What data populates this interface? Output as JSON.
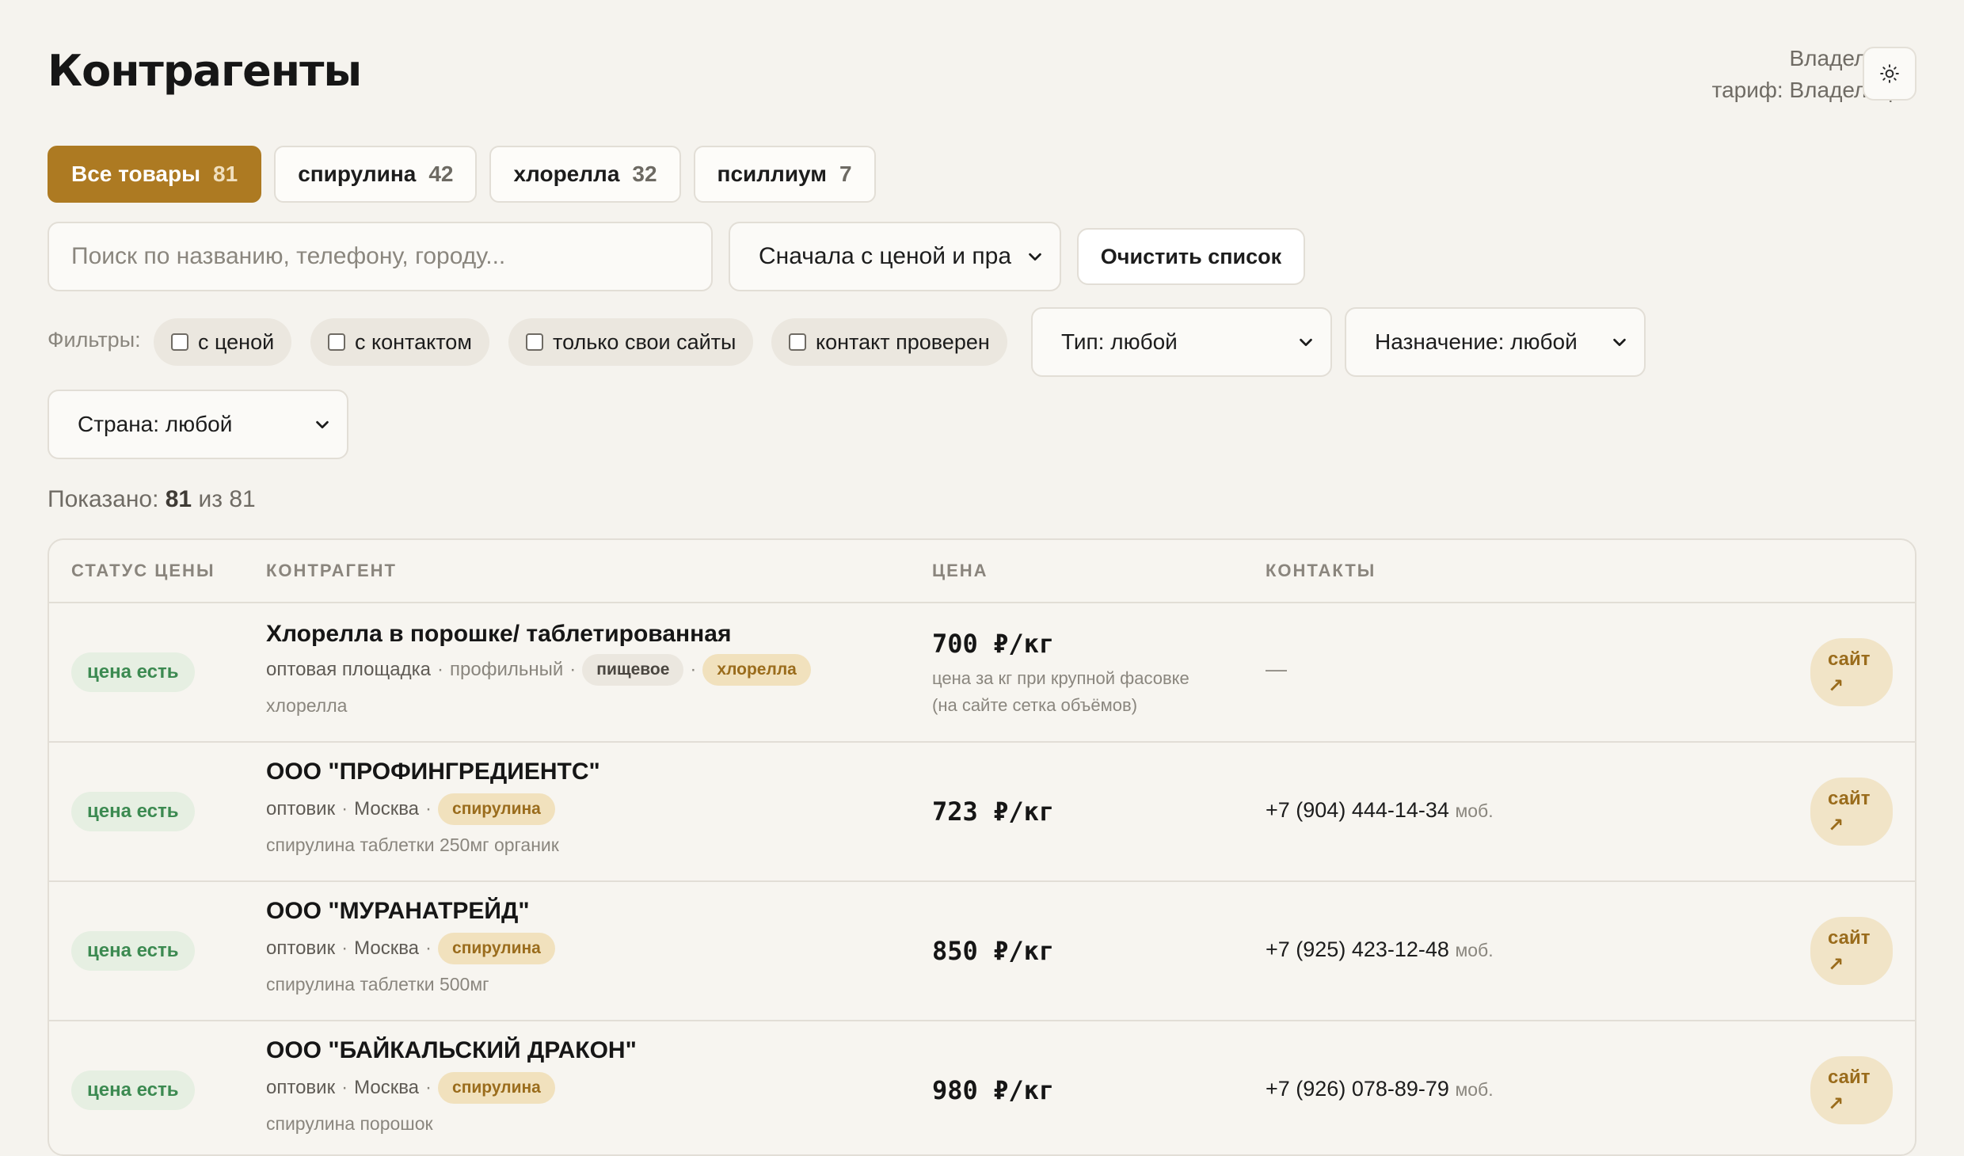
{
  "page": {
    "title": "Контрагенты"
  },
  "user": {
    "name": "Владелец",
    "plan": "тариф: Владелец"
  },
  "icons": {
    "theme": "sun-icon",
    "select": "chevron-down-icon"
  },
  "tabs": [
    {
      "label": "Все товары",
      "count": "81",
      "active": true
    },
    {
      "label": "спирулина",
      "count": "42"
    },
    {
      "label": "хлорелла",
      "count": "32"
    },
    {
      "label": "псиллиум",
      "count": "7"
    }
  ],
  "search": {
    "placeholder": "Поиск по названию, телефону, городу..."
  },
  "sort": {
    "value": "Сначала с ценой и пра"
  },
  "clear_label": "Очистить список",
  "filters": {
    "label": "Фильтры:",
    "checks": [
      "с ценой",
      "с контактом",
      "только свои сайты",
      "контакт проверен"
    ],
    "type": "Тип: любой",
    "purpose": "Назначение: любой",
    "country": "Страна: любой"
  },
  "shown": {
    "prefix": "Показано:",
    "count": "81",
    "suffix": "из 81"
  },
  "table": {
    "headers": [
      "СТАТУС ЦЕНЫ",
      "КОНТРАГЕНТ",
      "ЦЕНА",
      "КОНТАКТЫ"
    ],
    "rows": [
      {
        "status": "цена есть",
        "name": "Хлорелла в порошке/ таблетированная",
        "meta_type": "оптовая площадка",
        "meta_second": "профильный",
        "tag_category": "пищевое",
        "tag_product": "хлорелла",
        "desc": "хлорелла",
        "price": "700 ₽/кг",
        "price_note_1": "цена за кг при крупной фасовке",
        "price_note_2": "(на сайте сетка объёмов)",
        "contact": "—",
        "contact_kind": "",
        "site": "сайт",
        "site_arrow": "↗"
      },
      {
        "status": "цена есть",
        "name": "ООО \"ПРОФИНГРЕДИЕНТС\"",
        "meta_type": "оптовик",
        "meta_second": "Москва",
        "tag_product": "спирулина",
        "desc": "спирулина таблетки 250мг органик",
        "price": "723 ₽/кг",
        "contact": "+7 (904) 444-14-34",
        "contact_kind": "моб.",
        "site": "сайт",
        "site_arrow": "↗"
      },
      {
        "status": "цена есть",
        "name": "ООО \"МУРАНАТРЕЙД\"",
        "meta_type": "оптовик",
        "meta_second": "Москва",
        "tag_product": "спирулина",
        "desc": "спирулина таблетки 500мг",
        "price": "850 ₽/кг",
        "contact": "+7 (925) 423-12-48",
        "contact_kind": "моб.",
        "site": "сайт",
        "site_arrow": "↗"
      },
      {
        "status": "цена есть",
        "name": "ООО \"БАЙКАЛЬСКИЙ ДРАКОН\"",
        "meta_type": "оптовик",
        "meta_second": "Москва",
        "tag_product": "спирулина",
        "desc": "спирулина порошок",
        "price": "980 ₽/кг",
        "contact": "+7 (926) 078-89-79",
        "contact_kind": "моб.",
        "site": "сайт",
        "site_arrow": "↗"
      }
    ]
  },
  "colors": {
    "accent": "#ad7a22",
    "background": "#f5f3ee",
    "status_green": "#3c8a51"
  }
}
